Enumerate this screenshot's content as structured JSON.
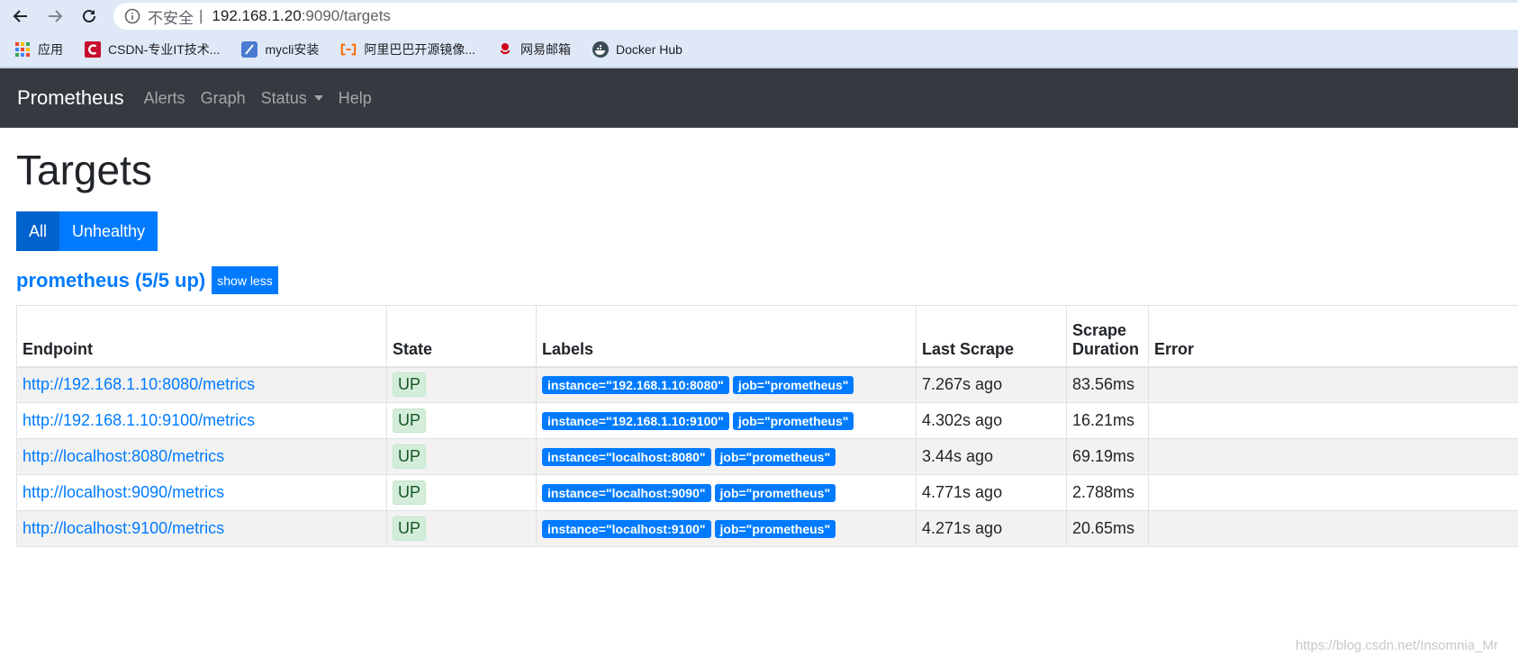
{
  "browser": {
    "insecure_label": "不安全",
    "separator": "|",
    "url_host": "192.168.1.20",
    "url_path": ":9090/targets",
    "bookmarks": [
      {
        "label": "应用",
        "icon": "apps-grid-icon"
      },
      {
        "label": "CSDN-专业IT技术...",
        "icon": "csdn-logo-icon",
        "color": "#c8102e"
      },
      {
        "label": "mycli安装",
        "icon": "feather-icon",
        "color": "#4a7bd1"
      },
      {
        "label": "阿里巴巴开源镜像...",
        "icon": "alibaba-logo-icon",
        "color": "#ff6a00"
      },
      {
        "label": "网易邮箱",
        "icon": "netease-logo-icon",
        "color": "#d0021b"
      },
      {
        "label": "Docker Hub",
        "icon": "docker-logo-icon",
        "color": "#394d54"
      }
    ]
  },
  "navbar": {
    "brand": "Prometheus",
    "links": [
      "Alerts",
      "Graph",
      "Status",
      "Help"
    ]
  },
  "page": {
    "title": "Targets",
    "filter_all": "All",
    "filter_unhealthy": "Unhealthy",
    "job_title": "prometheus (5/5 up)",
    "show_less": "show less"
  },
  "table": {
    "headers": {
      "endpoint": "Endpoint",
      "state": "State",
      "labels": "Labels",
      "last_scrape": "Last Scrape",
      "scrape_duration_1": "Scrape",
      "scrape_duration_2": "Duration",
      "error": "Error"
    },
    "rows": [
      {
        "endpoint": "http://192.168.1.10:8080/metrics",
        "state": "UP",
        "instance": "instance=\"192.168.1.10:8080\"",
        "job": "job=\"prometheus\"",
        "last_scrape": "7.267s ago",
        "duration": "83.56ms",
        "error": ""
      },
      {
        "endpoint": "http://192.168.1.10:9100/metrics",
        "state": "UP",
        "instance": "instance=\"192.168.1.10:9100\"",
        "job": "job=\"prometheus\"",
        "last_scrape": "4.302s ago",
        "duration": "16.21ms",
        "error": ""
      },
      {
        "endpoint": "http://localhost:8080/metrics",
        "state": "UP",
        "instance": "instance=\"localhost:8080\"",
        "job": "job=\"prometheus\"",
        "last_scrape": "3.44s ago",
        "duration": "69.19ms",
        "error": ""
      },
      {
        "endpoint": "http://localhost:9090/metrics",
        "state": "UP",
        "instance": "instance=\"localhost:9090\"",
        "job": "job=\"prometheus\"",
        "last_scrape": "4.771s ago",
        "duration": "2.788ms",
        "error": ""
      },
      {
        "endpoint": "http://localhost:9100/metrics",
        "state": "UP",
        "instance": "instance=\"localhost:9100\"",
        "job": "job=\"prometheus\"",
        "last_scrape": "4.271s ago",
        "duration": "20.65ms",
        "error": ""
      }
    ]
  },
  "watermark": "https://blog.csdn.net/Insomnia_Mr"
}
